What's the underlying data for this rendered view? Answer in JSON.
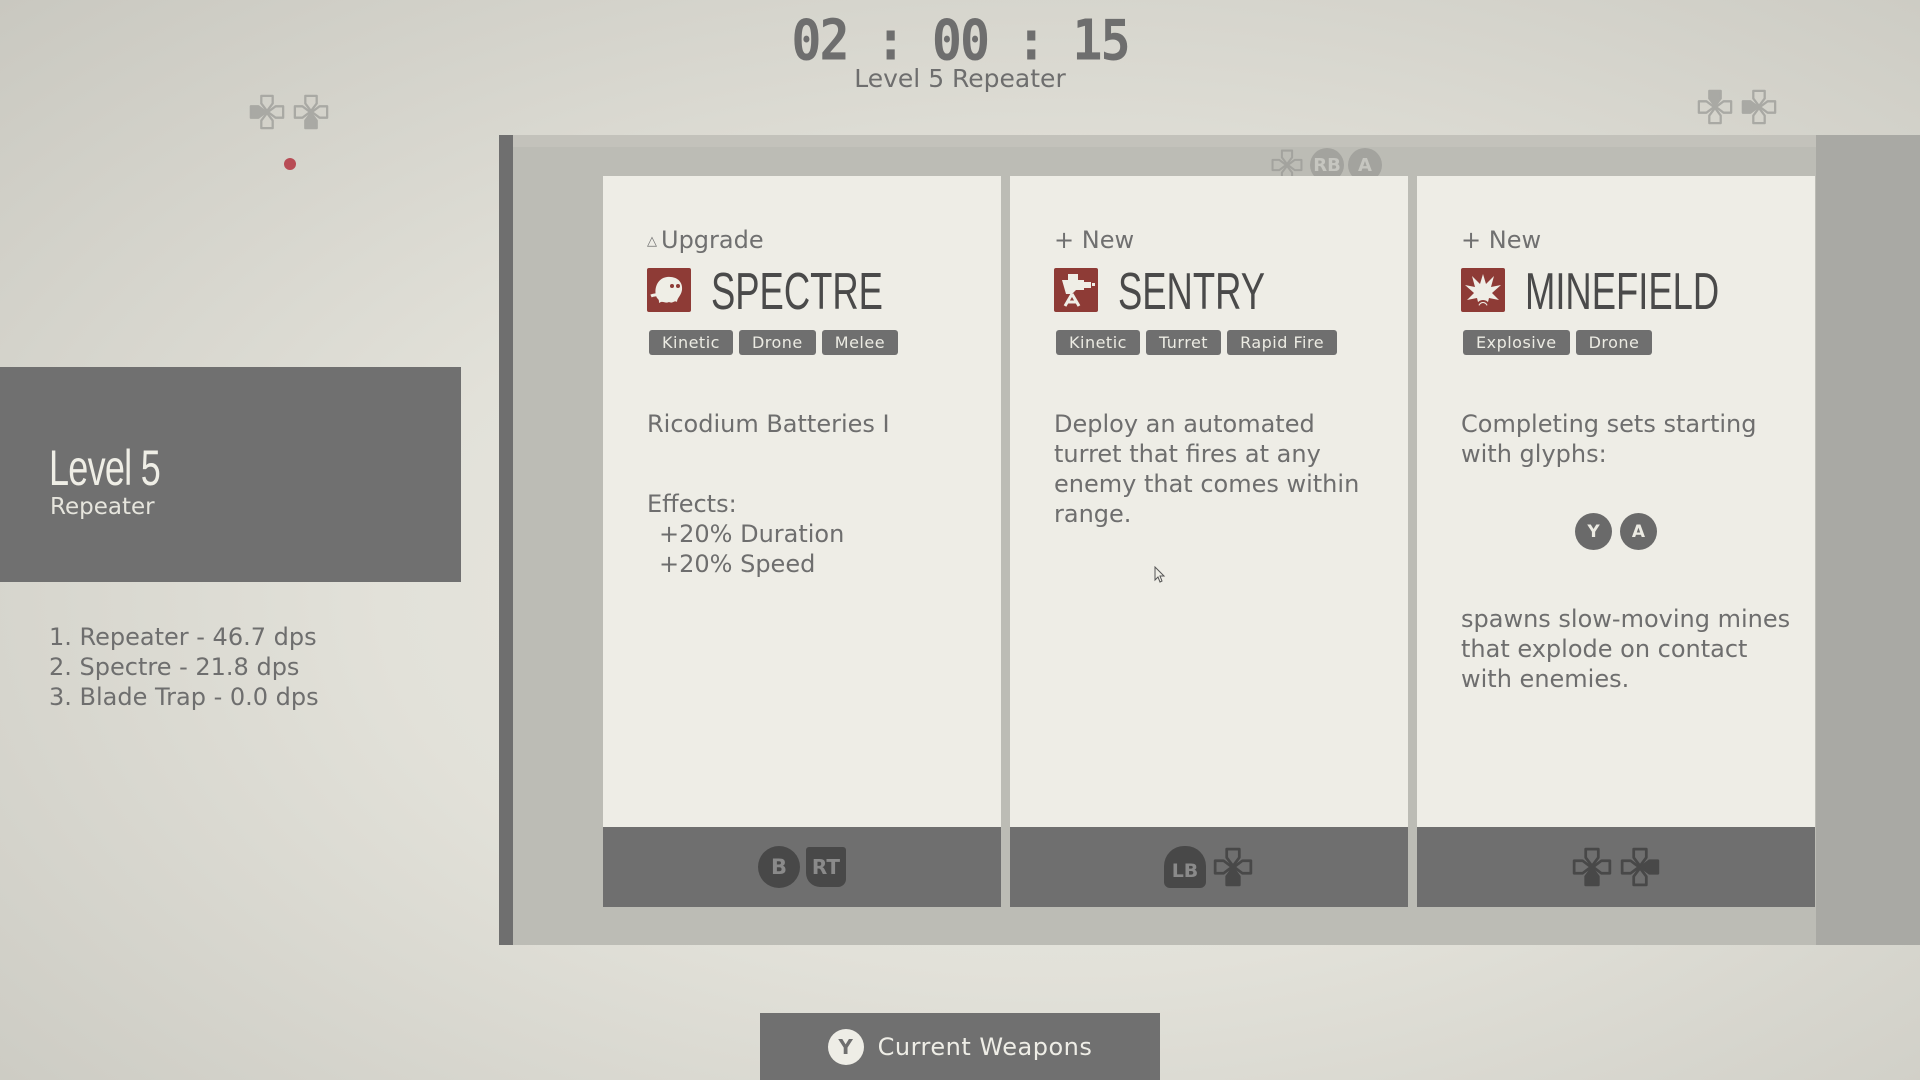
{
  "header": {
    "timer": "02 : 00 : 15",
    "subtitle": "Level 5 Repeater"
  },
  "left_panel": {
    "level_title": "Level 5",
    "weapon_name": "Repeater",
    "dps_list": [
      "1. Repeater - 46.7 dps",
      "2. Spectre - 21.8 dps",
      "3. Blade Trap - 0.0 dps"
    ]
  },
  "frame": {
    "top_glyphs": [
      "dpad-left",
      "RB",
      "A"
    ]
  },
  "cards": [
    {
      "kind": "Upgrade",
      "kind_icon": "triangle-up-icon",
      "name": "SPECTRE",
      "icon": "ghost-icon",
      "tags": [
        "Kinetic",
        "Drone",
        "Melee"
      ],
      "description": "Ricodium Batteries I",
      "effects_label": "Effects:",
      "effects": [
        "+20% Duration",
        "+20% Speed"
      ],
      "footer_buttons": [
        "B",
        "RT"
      ]
    },
    {
      "kind": "+ New",
      "name": "SENTRY",
      "icon": "turret-icon",
      "tags": [
        "Kinetic",
        "Turret",
        "Rapid Fire"
      ],
      "description": "Deploy an automated turret that fires at any enemy that comes within range.",
      "footer_buttons": [
        "LB",
        "dpad-down"
      ]
    },
    {
      "kind": "+ New",
      "name": "MINEFIELD",
      "icon": "explosion-icon",
      "tags": [
        "Explosive",
        "Drone"
      ],
      "description": "Completing sets starting with glyphs:",
      "glyphs": [
        "Y",
        "A"
      ],
      "description2": "spawns slow-moving mines that explode on contact with enemies.",
      "footer_buttons": [
        "dpad-down",
        "dpad-right"
      ]
    }
  ],
  "bottom_button": {
    "glyph": "Y",
    "label": "Current Weapons"
  },
  "colors": {
    "accent_red": "#8e3b36",
    "indicator_dot": "#b84c55",
    "panel_gray": "#707070",
    "card_bg": "#eeede6"
  }
}
